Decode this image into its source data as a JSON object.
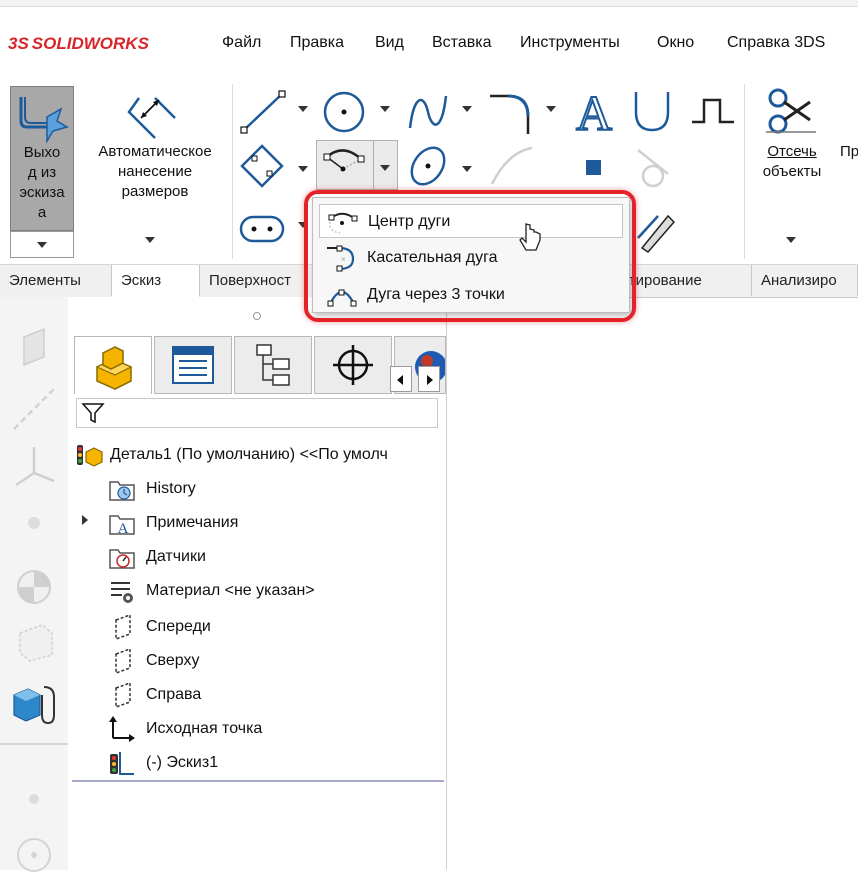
{
  "app": {
    "logo_ds": "3S",
    "logo_name": "SOLIDWORKS"
  },
  "menu": [
    "Файл",
    "Правка",
    "Вид",
    "Вставка",
    "Инструменты",
    "Окно",
    "Справка 3DS"
  ],
  "ribbon": {
    "exit_sketch": [
      "Выхо",
      "д из",
      "эскиза",
      "а"
    ],
    "smart_dimension": [
      "Автоматическое",
      "нанесение",
      "размеров"
    ],
    "trim": [
      "Отсечь",
      "объекты"
    ],
    "trim_more": "Пр"
  },
  "tabs": [
    "Элементы",
    "Эскиз",
    "Поверхност",
    "ктирование",
    "Анализиро"
  ],
  "flyout": {
    "items": [
      "Центр дуги",
      "Касательная дуга",
      "Дуга через 3 точки"
    ]
  },
  "tree": {
    "root": "Деталь1 (По умолчанию) <<По умолч",
    "items": [
      "History",
      "Примечания",
      "Датчики",
      "Материал <не указан>",
      "Спереди",
      "Сверху",
      "Справа",
      "Исходная точка",
      "(-) Эскиз1"
    ]
  },
  "colors": {
    "accent_blue": "#1e5a9a",
    "highlight_red": "#e32329",
    "brand_red": "#d8262a"
  }
}
